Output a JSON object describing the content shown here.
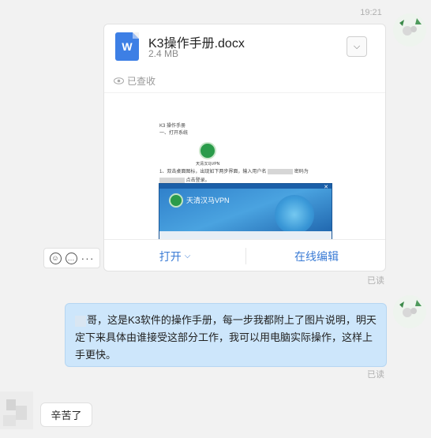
{
  "chat": {
    "timestamp": "19:21",
    "file_message": {
      "file_name": "K3操作手册.docx",
      "file_size": "2.4 MB",
      "doc_icon_letter": "W",
      "read_status": "已查收",
      "preview": {
        "title": "K3 操作手册",
        "subtitle": "一、打开系统",
        "logo_caption": "天清汉马VPN",
        "line1": "1、双击桌面图标",
        "line1_tail": "，出现如下两步界面，输入用户名",
        "line1_end": "密码为",
        "line2_end": "点击登录。",
        "vpn_title": "天清汉马VPN"
      },
      "actions": {
        "open_label": "打开",
        "open_chevron": "⌵",
        "edit_label": "在线编辑"
      },
      "more_chevron": "⌵"
    },
    "reactions": {
      "emoji_icon": "☺",
      "comment_icon": "…",
      "more_dots": "···"
    },
    "read_label_1": "已读",
    "outgoing_message": "哥，这是K3软件的操作手册，每一步我都附上了图片说明，明天定下来具体由谁接受这部分工作，我可以用电脑实际操作，这样上手更快。",
    "read_label_2": "已读",
    "incoming_reply": "辛苦了"
  },
  "colors": {
    "accent": "#3a7bd5",
    "bubble_out": "#cde6fb",
    "doc_blue": "#3d7fe5"
  }
}
